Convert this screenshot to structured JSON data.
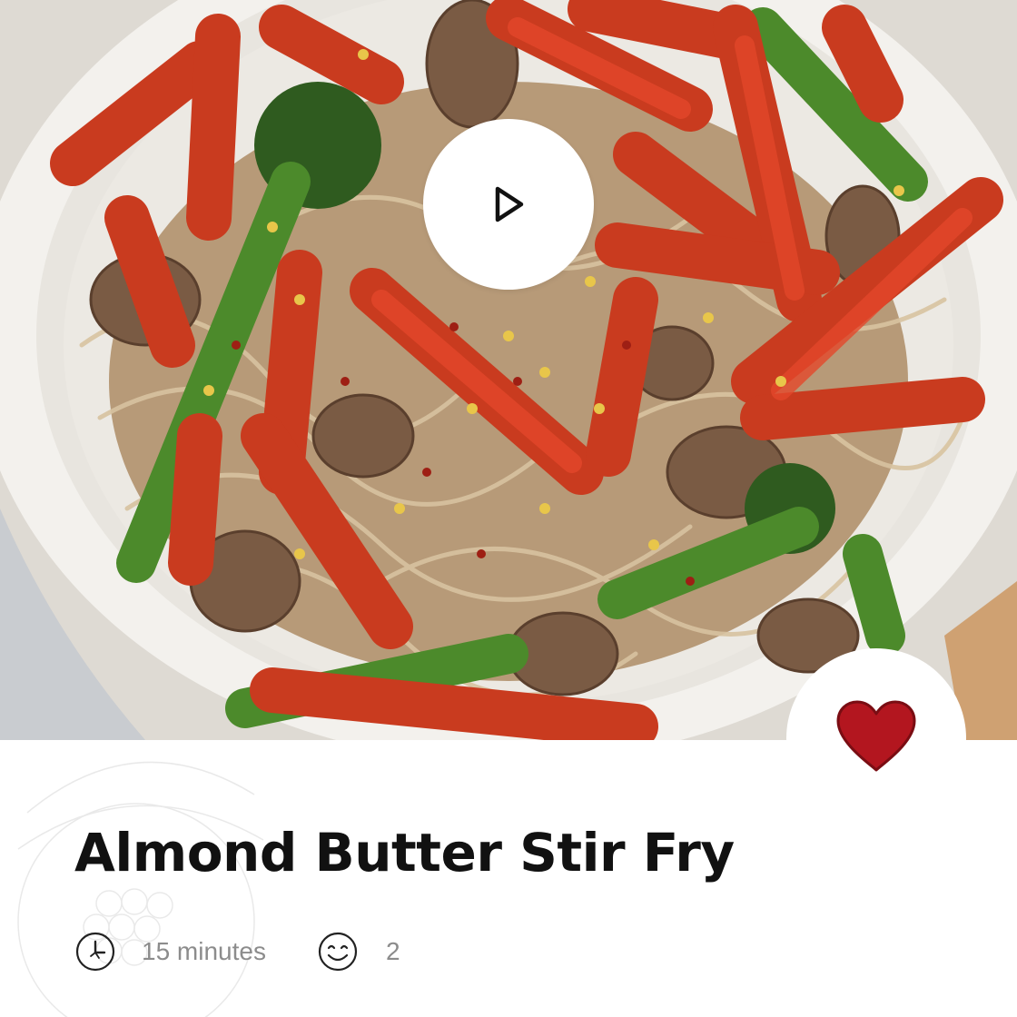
{
  "recipe": {
    "title": "Almond Butter Stir Fry",
    "time": "15 minutes",
    "servings": "2"
  },
  "icons": {
    "play": "play-icon",
    "favorite": "heart-icon",
    "time": "clock-icon",
    "servings": "smiley-face-icon"
  },
  "colors": {
    "heart": "#b3161f",
    "title": "#111111",
    "meta_text": "#8c8c8c"
  },
  "favorite": {
    "is_favorited": true
  }
}
